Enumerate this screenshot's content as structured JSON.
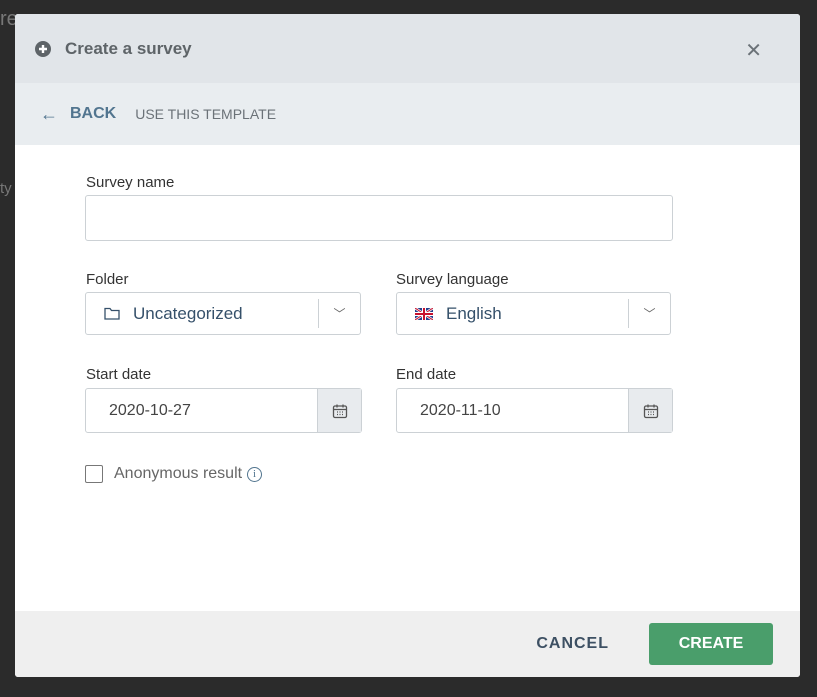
{
  "background": {
    "fragment_top": "re",
    "fragment_mid": "ty"
  },
  "header": {
    "title": "Create a survey",
    "icon": "plus-circle-icon",
    "close_icon": "close-icon"
  },
  "subheader": {
    "back_label": "BACK",
    "template_label": "USE THIS TEMPLATE"
  },
  "form": {
    "survey_name": {
      "label": "Survey name",
      "value": ""
    },
    "folder": {
      "label": "Folder",
      "value": "Uncategorized"
    },
    "language": {
      "label": "Survey language",
      "value": "English"
    },
    "start_date": {
      "label": "Start date",
      "value": "2020-10-27"
    },
    "end_date": {
      "label": "End date",
      "value": "2020-11-10"
    },
    "anonymous": {
      "label": "Anonymous result",
      "checked": false
    }
  },
  "footer": {
    "cancel_label": "CANCEL",
    "create_label": "CREATE"
  },
  "colors": {
    "primary": "#4a9e6b",
    "link": "#52758f"
  }
}
